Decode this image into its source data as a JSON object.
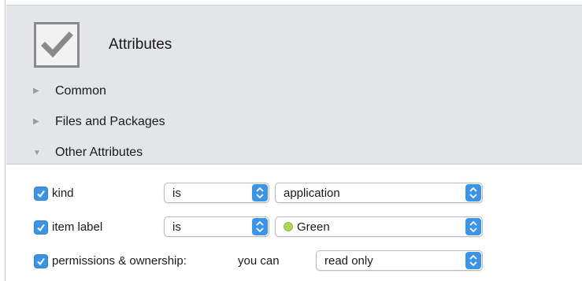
{
  "header": {
    "title": "Attributes",
    "icon": "checkbox-icon"
  },
  "sections": [
    {
      "label": "Common",
      "expanded": false
    },
    {
      "label": "Files and Packages",
      "expanded": false
    },
    {
      "label": "Other Attributes",
      "expanded": true
    }
  ],
  "criteria": [
    {
      "checked": true,
      "label": "kind",
      "operator": "is",
      "value": "application"
    },
    {
      "checked": true,
      "label": "item label",
      "operator": "is",
      "value": "Green",
      "value_color": "#a8d85a"
    },
    {
      "checked": true,
      "label": "permissions & ownership:",
      "operator": "you can",
      "value": "read only"
    }
  ],
  "colors": {
    "accent": "#3b94e4",
    "panel_bg": "#e3e5e9"
  }
}
